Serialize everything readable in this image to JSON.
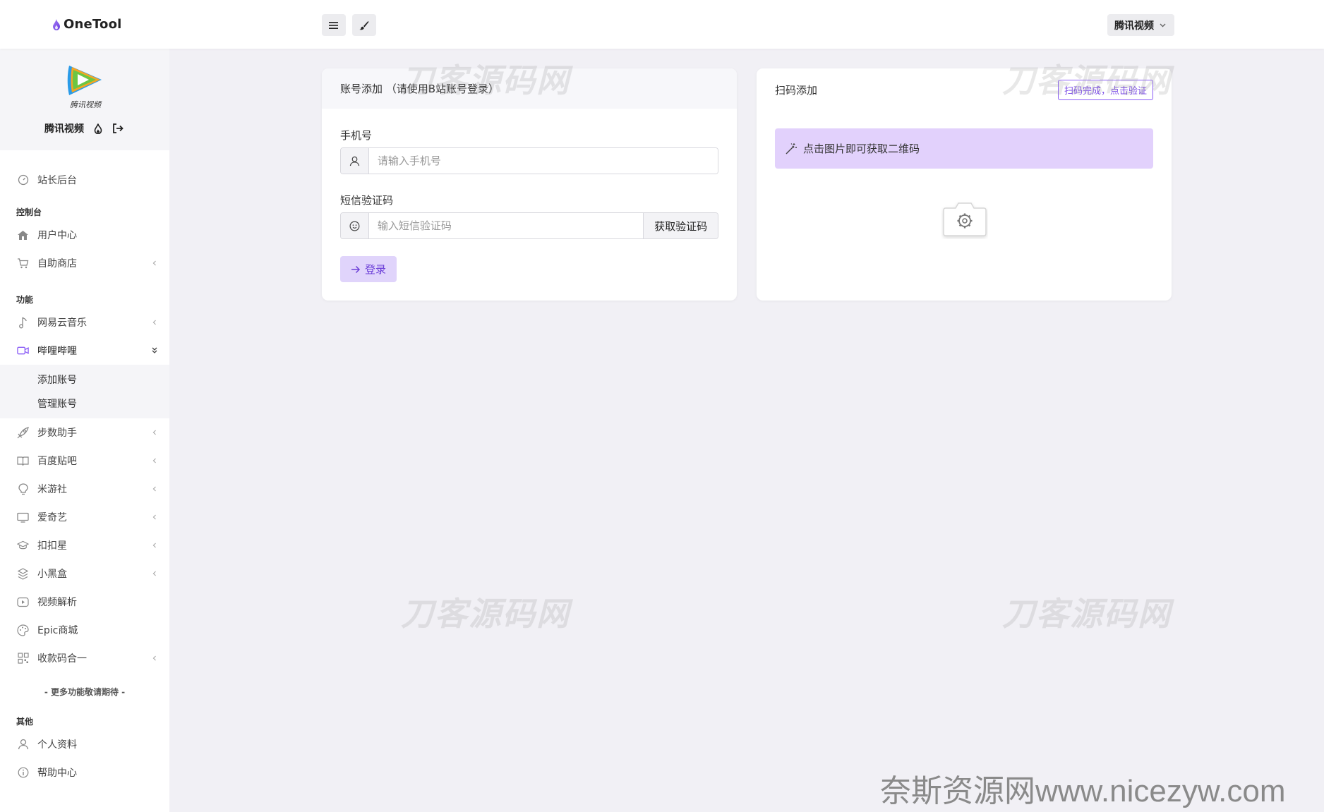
{
  "header": {
    "brand": "OneTool",
    "menu_icon": "hamburger-icon",
    "brush_icon": "brush-icon",
    "user_dropdown": "腾讯视频"
  },
  "sidebar": {
    "profile_name": "腾讯视频",
    "logo_caption": "腾讯视频",
    "dashboard": "站长后台",
    "section_console": "控制台",
    "user_center": "用户中心",
    "shop": "自助商店",
    "section_features": "功能",
    "netease": "网易云音乐",
    "bilibili": "哔哩哔哩",
    "sub_add": "添加账号",
    "sub_manage": "管理账号",
    "steps": "步数助手",
    "tieba": "百度贴吧",
    "miyoushe": "米游社",
    "iqiyi": "爱奇艺",
    "koukou": "扣扣星",
    "xiaoheihe": "小黑盒",
    "video_parse": "视频解析",
    "epic": "Epic商城",
    "qrcode_merge": "收款码合一",
    "more_note": "- 更多功能敬请期待 -",
    "section_other": "其他",
    "profile": "个人资料",
    "help": "帮助中心"
  },
  "left_card": {
    "title": "账号添加 （请使用B站账号登录）",
    "phone_label": "手机号",
    "phone_placeholder": "请输入手机号",
    "code_label": "短信验证码",
    "code_placeholder": "输入短信验证码",
    "get_code": "获取验证码",
    "login": "登录"
  },
  "right_card": {
    "title": "扫码添加",
    "verify_button": "扫码完成，点击验证",
    "alert_text": "点击图片即可获取二维码"
  },
  "watermarks": {
    "site_cn": "刀客源码网",
    "footer": "奈斯资源网www.nicezyw.com"
  },
  "colors": {
    "accent": "#7b4ce6",
    "accent_light": "#e2d1fc",
    "page_bg": "#f1f0f5"
  }
}
